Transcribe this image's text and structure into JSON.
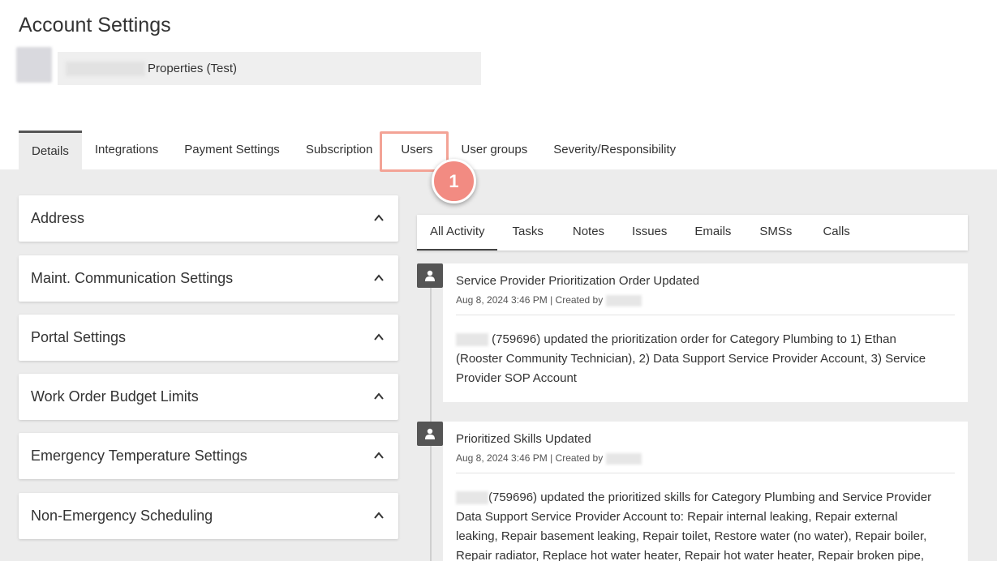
{
  "page": {
    "title": "Account Settings"
  },
  "account": {
    "name": "Properties (Test)"
  },
  "tabs": [
    {
      "label": "Details",
      "active": true
    },
    {
      "label": "Integrations"
    },
    {
      "label": "Payment Settings"
    },
    {
      "label": "Subscription"
    },
    {
      "label": "Users"
    },
    {
      "label": "User groups"
    },
    {
      "label": "Severity/Responsibility"
    }
  ],
  "annotation": {
    "step": "1"
  },
  "panels": [
    {
      "title": "Address"
    },
    {
      "title": "Maint. Communication Settings"
    },
    {
      "title": "Portal Settings"
    },
    {
      "title": "Work Order Budget Limits"
    },
    {
      "title": "Emergency Temperature Settings"
    },
    {
      "title": "Non-Emergency Scheduling"
    }
  ],
  "activity_tabs": [
    {
      "label": "All Activity",
      "active": true
    },
    {
      "label": "Tasks"
    },
    {
      "label": "Notes"
    },
    {
      "label": "Issues"
    },
    {
      "label": "Emails"
    },
    {
      "label": "SMSs"
    },
    {
      "label": "Calls"
    }
  ],
  "activities": [
    {
      "title": "Service Provider Prioritization Order Updated",
      "meta": "Aug 8, 2024 3:46 PM | Created by",
      "body": "(759696) updated the prioritization order for Category Plumbing to 1) Ethan (Rooster Community Technician), 2) Data Support Service Provider Account, 3) Service Provider SOP Account"
    },
    {
      "title": "Prioritized Skills Updated",
      "meta": "Aug 8, 2024 3:46 PM | Created by",
      "body": "(759696) updated the prioritized skills for Category Plumbing and Service Provider Data Support Service Provider Account to: Repair internal leaking, Repair external leaking, Repair basement leaking, Repair toilet, Restore water (no water), Repair boiler, Repair radiator, Replace hot water heater, Repair hot water heater, Repair broken pipe, Extract"
    }
  ]
}
